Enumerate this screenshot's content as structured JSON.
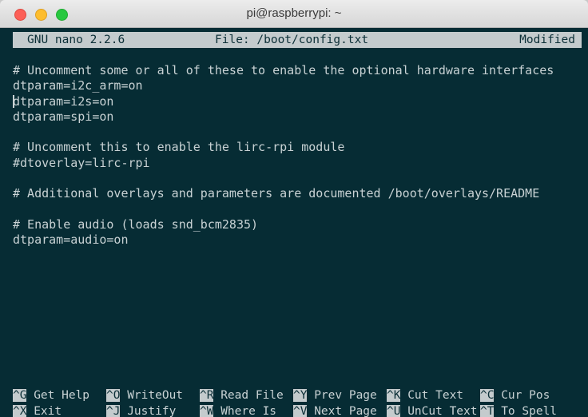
{
  "window": {
    "title": "pi@raspberrypi: ~"
  },
  "nano": {
    "version": "GNU nano 2.2.6",
    "file": "File: /boot/config.txt",
    "status": "Modified"
  },
  "editor": {
    "lines": [
      "# Uncomment some or all of these to enable the optional hardware interfaces",
      "dtparam=i2c_arm=on",
      "dtparam=i2s=on",
      "dtparam=spi=on",
      "",
      "# Uncomment this to enable the lirc-rpi module",
      "#dtoverlay=lirc-rpi",
      "",
      "# Additional overlays and parameters are documented /boot/overlays/README",
      "",
      "# Enable audio (loads snd_bcm2835)",
      "dtparam=audio=on"
    ]
  },
  "shortcuts": [
    [
      {
        "key": "^G",
        "label": "Get Help"
      },
      {
        "key": "^O",
        "label": "WriteOut"
      },
      {
        "key": "^R",
        "label": "Read File"
      },
      {
        "key": "^Y",
        "label": "Prev Page"
      },
      {
        "key": "^K",
        "label": "Cut Text"
      },
      {
        "key": "^C",
        "label": "Cur Pos"
      }
    ],
    [
      {
        "key": "^X",
        "label": "Exit"
      },
      {
        "key": "^J",
        "label": "Justify"
      },
      {
        "key": "^W",
        "label": "Where Is"
      },
      {
        "key": "^V",
        "label": "Next Page"
      },
      {
        "key": "^U",
        "label": "UnCut Text"
      },
      {
        "key": "^T",
        "label": "To Spell"
      }
    ]
  ]
}
